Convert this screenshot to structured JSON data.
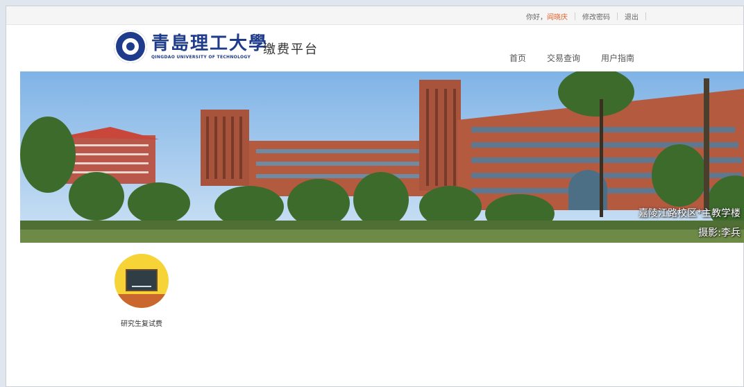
{
  "topbar": {
    "greeting": "你好，",
    "username": "阎晓庆",
    "change_password": "修改密码",
    "logout": "退出"
  },
  "header": {
    "logo_cn": "青島理工大學",
    "logo_en": "QINGDAO UNIVERSITY OF TECHNOLOGY",
    "platform_title": "缴费平台",
    "nav": [
      {
        "label": "首页"
      },
      {
        "label": "交易查询"
      },
      {
        "label": "用户指南"
      }
    ]
  },
  "banner": {
    "location_caption": "嘉陵江路校区*主教学楼",
    "photo_credit": "摄影:李兵"
  },
  "services": [
    {
      "label": "研究生复试费",
      "icon": "blackboard-icon"
    }
  ],
  "colors": {
    "accent_user": "#e0632c",
    "brand_blue": "#1f3c8c",
    "tile_yellow": "#f6d336"
  }
}
